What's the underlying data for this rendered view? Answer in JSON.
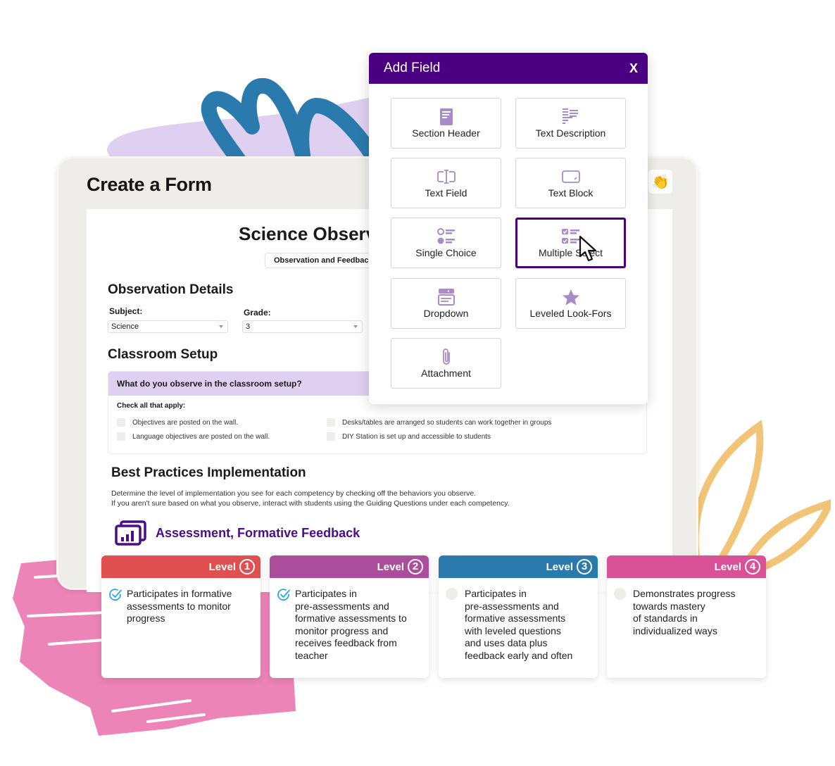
{
  "app": {
    "title": "Create a Form",
    "reaction_icon": "clapping-hands-icon",
    "reaction_glyph": "👏"
  },
  "form": {
    "title": "Science Observation",
    "badge": "Observation and Feedback",
    "observation_details": {
      "heading": "Observation Details",
      "subject_label": "Subject:",
      "subject_value": "Science",
      "grade_label": "Grade:",
      "grade_value": "3"
    },
    "classroom_setup": {
      "heading": "Classroom Setup",
      "question": "What do you observe in the classroom setup?",
      "hint": "Check all that apply:",
      "options": [
        "Objectives are posted on the wall.",
        "Language objectives are posted on the wall.",
        "Desks/tables are arranged so students can work together in groups",
        "DIY Station is set up and accessible to students"
      ]
    },
    "best_practices": {
      "heading": "Best Practices Implementation",
      "description_line1": "Determine the level of implementation you see for each competency by checking off the behaviors you observe.",
      "description_line2": "If you aren't sure based on what you observe, interact with students using the Guiding Questions under each competency.",
      "competency": "Assessment, Formative Feedback"
    }
  },
  "levels": [
    {
      "label": "Level",
      "number": "1",
      "color": "#e05050",
      "checked": true,
      "text": "Participates in formative\nassessments to monitor\nprogress"
    },
    {
      "label": "Level",
      "number": "2",
      "color": "#ab4f9d",
      "checked": true,
      "text": "Participates in\npre-assessments and\nformative assessments to\nmonitor progress and\nreceives feedback from\nteacher"
    },
    {
      "label": "Level",
      "number": "3",
      "color": "#2a7aad",
      "checked": false,
      "text": "Participates in\npre-assessments and\nformative assessments\nwith leveled questions\nand uses data plus\nfeedback early and often"
    },
    {
      "label": "Level",
      "number": "4",
      "color": "#d95196",
      "checked": false,
      "text": "Demonstrates progress\ntowards mastery\nof standards in\nindividualized ways"
    }
  ],
  "modal": {
    "title": "Add Field",
    "close_label": "X",
    "accent": "#4b0082",
    "icon_color": "#a88bc7",
    "fields": [
      {
        "label": "Section Header",
        "icon": "section-header-icon"
      },
      {
        "label": "Text Description",
        "icon": "text-description-icon"
      },
      {
        "label": "Text Field",
        "icon": "text-field-icon"
      },
      {
        "label": "Text Block",
        "icon": "text-block-icon"
      },
      {
        "label": "Single Choice",
        "icon": "single-choice-icon"
      },
      {
        "label": "Multiple Select",
        "icon": "multiple-select-icon",
        "selected": true
      },
      {
        "label": "Dropdown",
        "icon": "dropdown-icon"
      },
      {
        "label": "Leveled Look-Fors",
        "icon": "star-icon"
      },
      {
        "label": "Attachment",
        "icon": "paperclip-icon"
      }
    ]
  }
}
